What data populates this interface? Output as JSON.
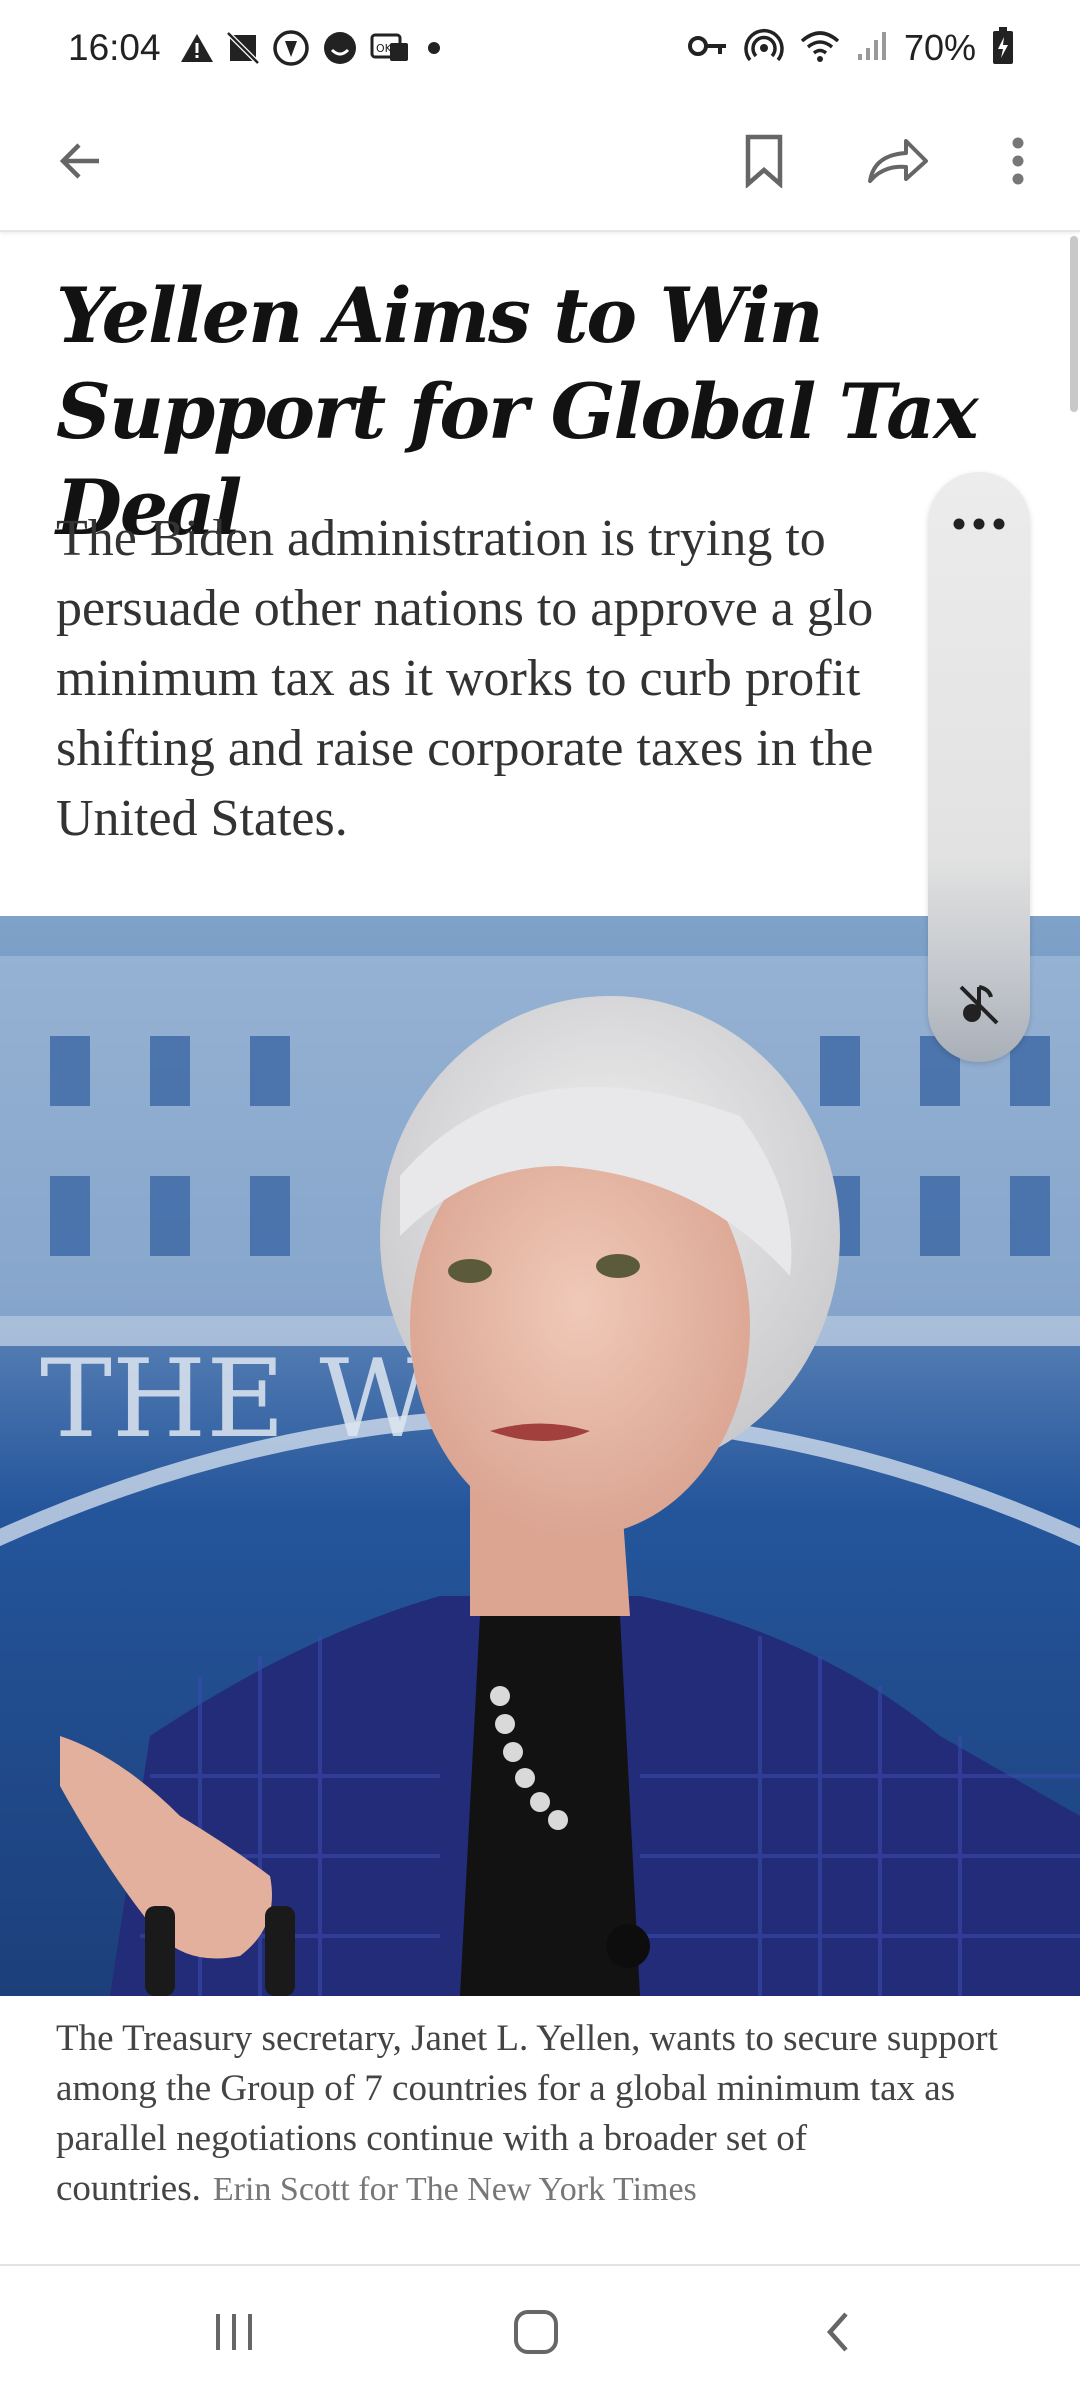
{
  "status_bar": {
    "time": "16:04",
    "left_icons": [
      "alert-icon",
      "no-sim-icon",
      "circle-badge-icon",
      "smiley-badge-icon",
      "ok-badge-icon",
      "dot-icon"
    ],
    "right_icons": [
      "key-icon",
      "hotspot-icon",
      "wifi-icon",
      "signal-icon",
      "battery-icon"
    ],
    "battery": "70%"
  },
  "app_bar": {
    "icons": [
      "back-arrow-icon",
      "bookmark-icon",
      "share-icon",
      "more-vertical-icon"
    ]
  },
  "article": {
    "headline": "Yellen Aims to Win Support for Global Tax Deal",
    "summary": "The Biden administration is trying to persuade other nations to approve a glo minimum tax as it works to curb profit shifting and raise corporate taxes in the United States.",
    "photo_sign_text": "THE W HOU",
    "caption": "The Treasury secretary, Janet L. Yellen, wants to secure support among the Group of 7 countries for a global minimum tax as parallel negotiations continue with a broader set of countries.",
    "credit": "Erin Scott for The New York Times"
  },
  "float_panel": {
    "icons": [
      "more-horizontal-icon",
      "mute-icon"
    ]
  },
  "nav_bar": {
    "icons": [
      "recents-icon",
      "home-icon",
      "back-icon"
    ]
  },
  "colors": {
    "text": "#121212",
    "summary_text": "#333333",
    "caption_text": "#444444",
    "photo_blue": "#2a4f8f"
  }
}
